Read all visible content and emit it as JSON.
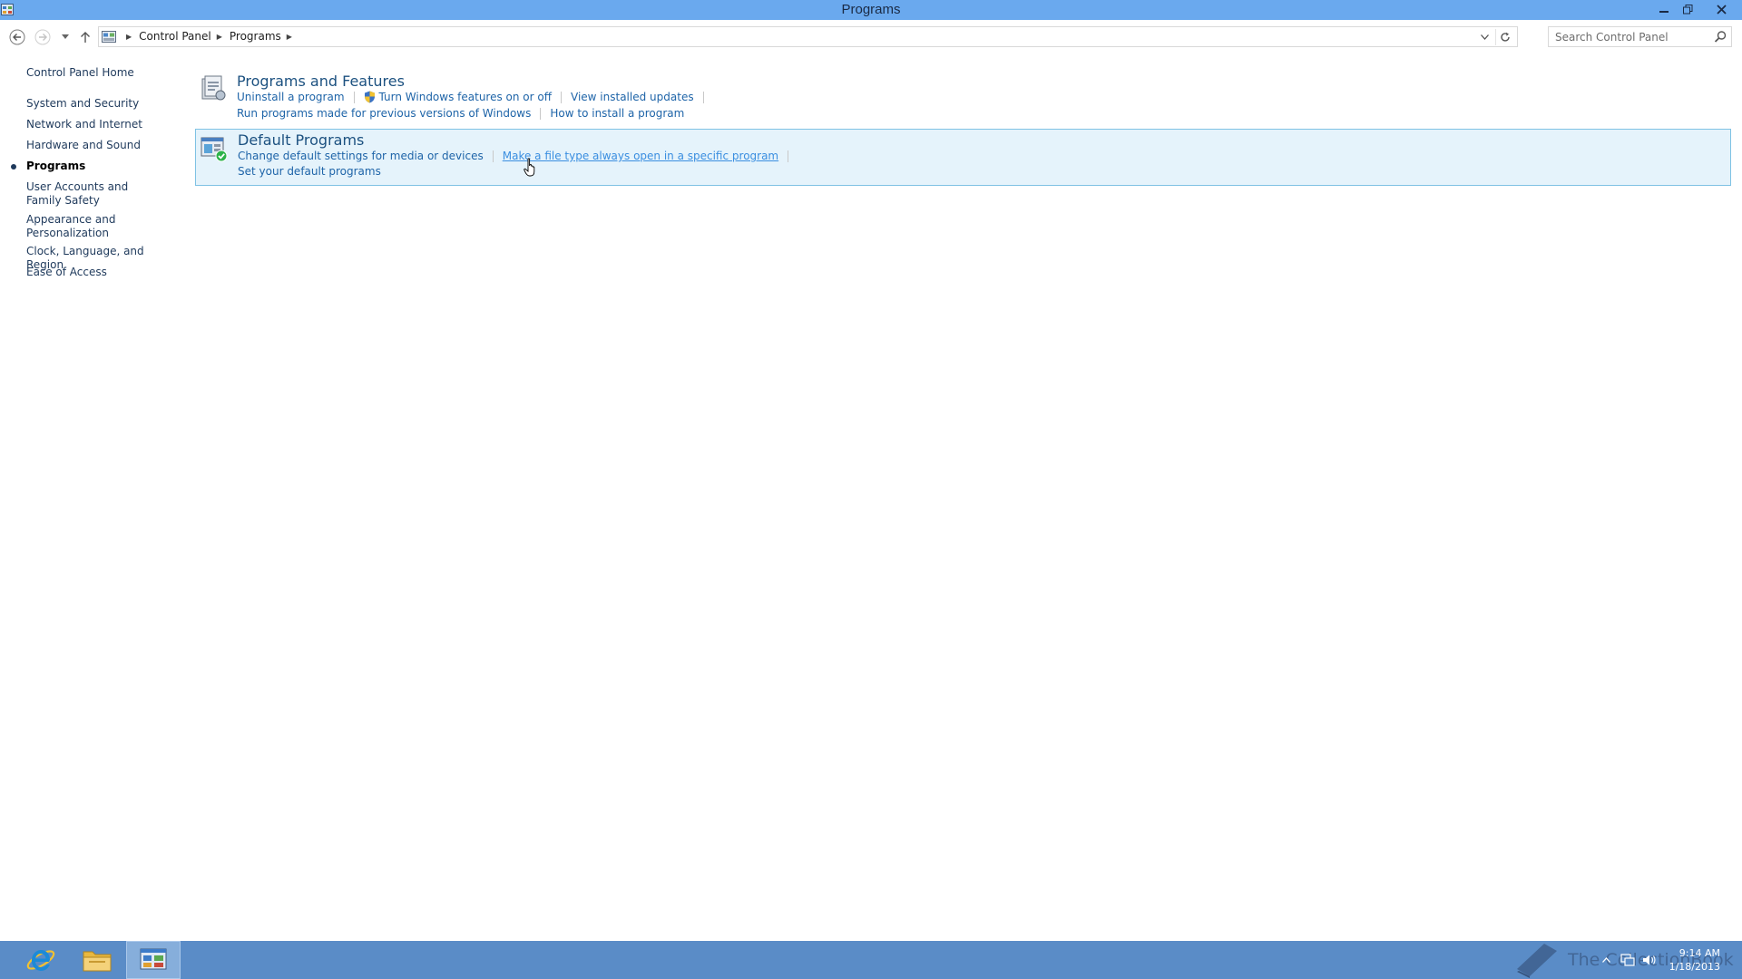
{
  "window": {
    "title": "Programs"
  },
  "address_bar": {
    "crumbs": [
      "Control Panel",
      "Programs"
    ]
  },
  "search": {
    "placeholder": "Search Control Panel"
  },
  "left_nav": {
    "home": "Control Panel Home",
    "items": [
      "System and Security",
      "Network and Internet",
      "Hardware and Sound",
      "Programs",
      "User Accounts and Family Safety",
      "Appearance and Personalization",
      "Clock, Language, and Region",
      "Ease of Access"
    ],
    "active_item": "Programs"
  },
  "categories": [
    {
      "title": "Programs and Features",
      "rows": [
        [
          "Uninstall a program",
          "Turn Windows features on or off",
          "View installed updates"
        ],
        [
          "Run programs made for previous versions of Windows",
          "How to install a program"
        ]
      ]
    },
    {
      "title": "Default Programs",
      "rows": [
        [
          "Change default settings for media or devices",
          "Make a file type always open in a specific program"
        ],
        [
          "Set your default programs"
        ]
      ]
    }
  ],
  "taskbar": {
    "watermark": "The CollectionBook",
    "time": "9:14 AM",
    "date": "1/18/2013"
  },
  "colors": {
    "titlebar": "#6aa9ee",
    "taskbar": "#5a8cc7",
    "link": "#1e64a8",
    "category_title": "#1c5180",
    "highlight_bg": "#e5f3fb",
    "highlight_border": "#7fc2e4"
  },
  "icons": {
    "window": "control-panel-icon",
    "back": "back-arrow-icon",
    "forward": "forward-arrow-icon",
    "recent": "chevron-down-icon",
    "up": "up-arrow-icon",
    "refresh": "refresh-icon",
    "search": "search-icon",
    "shield": "uac-shield-icon"
  }
}
